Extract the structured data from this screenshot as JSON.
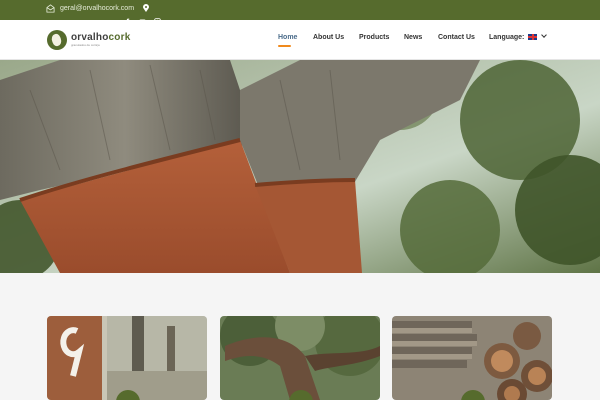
{
  "topbar": {
    "email": "geral@orvalhocork.com",
    "icons": [
      "envelope-icon",
      "location-pin-icon",
      "facebook-icon",
      "youtube-icon",
      "instagram-icon"
    ]
  },
  "brand": {
    "name_part1": "orvalho",
    "name_part2": "cork",
    "tagline": "granulados de cortiça"
  },
  "nav": {
    "items": [
      "Home",
      "About Us",
      "Products",
      "News",
      "Contact Us"
    ],
    "active": "Home",
    "language_label": "Language:",
    "language_flag": "uk-flag-icon"
  },
  "hero": {
    "image": "cork-oak-trunk-photo"
  },
  "cards": {
    "items": [
      "cork-number-nine-photo",
      "cork-oak-tree-photo",
      "cork-planks-stack-photo"
    ]
  },
  "colors": {
    "brand_green": "#566b2d",
    "accent_orange": "#f08a1d",
    "active_nav": "#4a6b8a",
    "page_bg": "#f5f5f5"
  }
}
